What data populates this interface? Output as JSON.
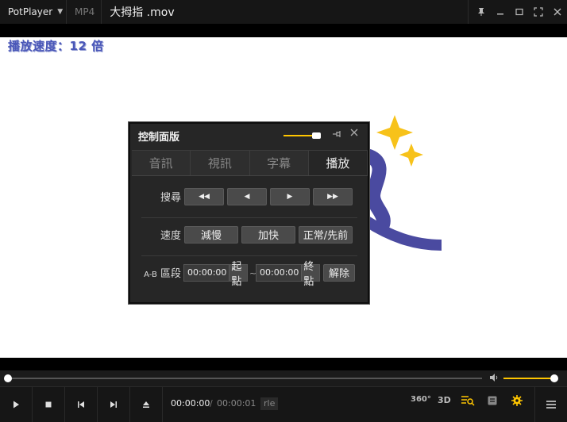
{
  "titlebar": {
    "app_name": "PotPlayer",
    "format": "MP4",
    "filename": "大拇指 .mov"
  },
  "osd": {
    "text": "播放速度：12 倍"
  },
  "panel": {
    "title": "控制面版",
    "opacity_level": 0.9,
    "tabs": [
      {
        "label": "音訊",
        "active": false
      },
      {
        "label": "視訊",
        "active": false
      },
      {
        "label": "字幕",
        "active": false
      },
      {
        "label": "播放",
        "active": true
      }
    ],
    "seek": {
      "label": "搜尋",
      "buttons": [
        "◀◀",
        "◀",
        "▶",
        "▶▶"
      ]
    },
    "speed": {
      "label": "速度",
      "slower": "減慢",
      "faster": "加快",
      "normal": "正常/先前"
    },
    "ab": {
      "label_prefix": "A-B",
      "label": "區段",
      "start_time": "00:00:00",
      "start_btn": "起點",
      "tilde": "~",
      "end_time": "00:00:00",
      "end_btn": "終點",
      "clear_btn": "解除"
    }
  },
  "playback": {
    "current_time": "00:00:00",
    "separator": "/",
    "total_time": "00:00:01",
    "codec": "rle",
    "seek_position": 0,
    "volume_level": 1.0,
    "icon_360": "360°",
    "icon_3d": "3D"
  },
  "colors": {
    "accent": "#ffc600",
    "osd_text": "#4a57b8",
    "star": "#f7c21a",
    "thumb": "#4a4aa0"
  }
}
